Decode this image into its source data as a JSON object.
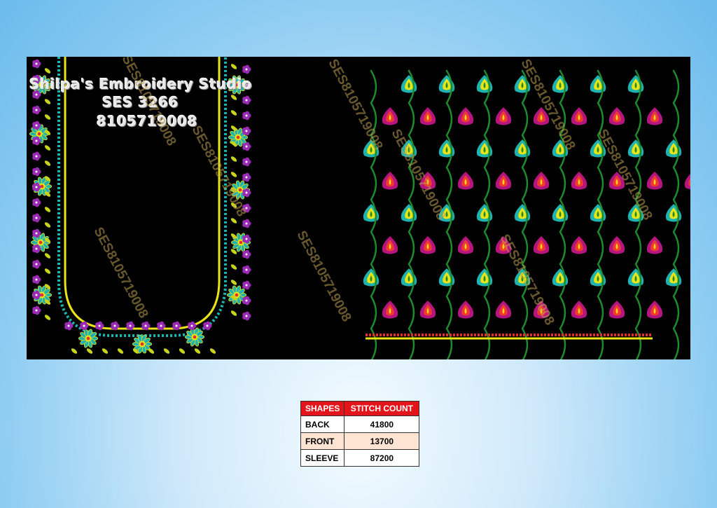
{
  "studio": {
    "name": "Shilpa's Embroidery Studio",
    "code": "SES 3266",
    "phone": "8105719008"
  },
  "watermark": "SES8105719008",
  "table": {
    "headers": [
      "SHAPES",
      "STITCH COUNT"
    ],
    "rows": [
      {
        "shape": "BACK",
        "count": "41800"
      },
      {
        "shape": "FRONT",
        "count": "13700"
      },
      {
        "shape": "SLEEVE",
        "count": "87200"
      }
    ]
  },
  "colors": {
    "background_top": "#6bbbec",
    "panel": "#000000",
    "header_red": "#e4141b",
    "motif_magenta": "#b5157e",
    "motif_teal": "#1fb3b0",
    "vine_green": "#1e8a2c",
    "border_yellow": "#e9e413"
  }
}
